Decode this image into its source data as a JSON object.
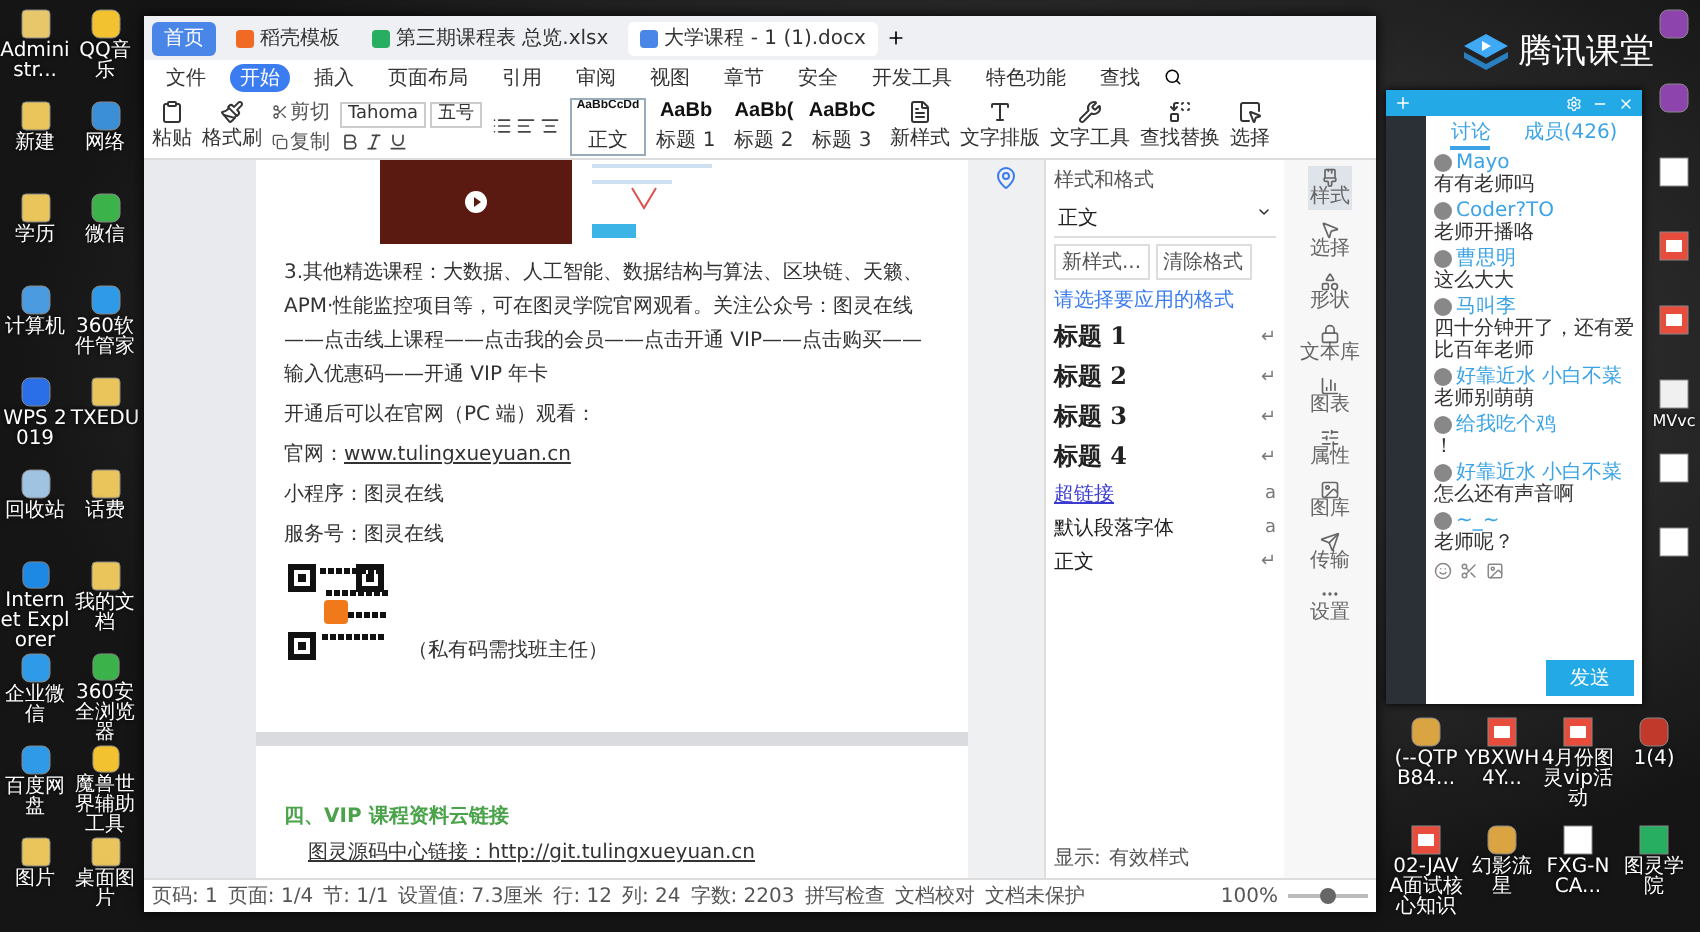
{
  "desktop_left": [
    {
      "label": "Administr...",
      "kind": "user"
    },
    {
      "label": "QQ音乐",
      "kind": "music"
    },
    {
      "label": "新建",
      "kind": "folder"
    },
    {
      "label": "网络",
      "kind": "network"
    },
    {
      "label": "学历",
      "kind": "folder"
    },
    {
      "label": "微信",
      "kind": "chat"
    },
    {
      "label": "计算机",
      "kind": "computer"
    },
    {
      "label": "360软件管家",
      "kind": "app"
    },
    {
      "label": "WPS 2019",
      "kind": "wps"
    },
    {
      "label": "TXEDU",
      "kind": "folder"
    },
    {
      "label": "回收站",
      "kind": "recycle"
    },
    {
      "label": "话费",
      "kind": "folder"
    },
    {
      "label": "Internet Explorer",
      "kind": "browser"
    },
    {
      "label": "我的文档",
      "kind": "folder"
    },
    {
      "label": "企业微信",
      "kind": "app"
    },
    {
      "label": "360安全浏览器",
      "kind": "chat"
    },
    {
      "label": "百度网盘",
      "kind": "app"
    },
    {
      "label": "魔兽世界辅助工具",
      "kind": "music"
    },
    {
      "label": "图片",
      "kind": "folder"
    },
    {
      "label": "桌面图片",
      "kind": "folder"
    }
  ],
  "desktop_right": [
    {
      "kind": "archive"
    },
    {
      "kind": "archive"
    },
    {
      "kind": "document"
    },
    {
      "kind": "pdf"
    },
    {
      "kind": "pdf"
    },
    {
      "kind": "blank",
      "label": "MVvc"
    },
    {
      "kind": "document"
    },
    {
      "kind": "document"
    }
  ],
  "desktop_bottom": [
    {
      "label": "(--QTPB84...",
      "kind": "image"
    },
    {
      "label": "YBXWH4Y...",
      "kind": "pdf"
    },
    {
      "label": "4月份图灵vip活动",
      "kind": "pdf"
    },
    {
      "label": "1(4)",
      "kind": "stamp"
    },
    {
      "label": "02-JAVA面试核心知识",
      "kind": "pdf"
    },
    {
      "label": "幻影流星",
      "kind": "image"
    },
    {
      "label": "FXG-NCA...",
      "kind": "document"
    },
    {
      "label": "图灵学院",
      "kind": "sheet"
    }
  ],
  "wps": {
    "tabs": [
      {
        "label": "首页",
        "kind": "home",
        "selected": false
      },
      {
        "label": "稻壳模板",
        "kind": "docer",
        "selected": false
      },
      {
        "label": "第三期课程表 总览.xlsx",
        "kind": "sheet",
        "selected": false
      },
      {
        "label": "大学课程 - 1 (1).docx",
        "kind": "doc",
        "selected": true
      }
    ],
    "menu": [
      {
        "label": "文件",
        "selected": false
      },
      {
        "label": "开始",
        "selected": true
      },
      {
        "label": "插入",
        "selected": false
      },
      {
        "label": "页面布局",
        "selected": false
      },
      {
        "label": "引用",
        "selected": false
      },
      {
        "label": "审阅",
        "selected": false
      },
      {
        "label": "视图",
        "selected": false
      },
      {
        "label": "章节",
        "selected": false
      },
      {
        "label": "安全",
        "selected": false
      },
      {
        "label": "开发工具",
        "selected": false
      },
      {
        "label": "特色功能",
        "selected": false
      },
      {
        "label": "查找",
        "selected": false
      }
    ],
    "clipboard": [
      {
        "label": "粘贴",
        "kind": "paste"
      },
      {
        "label": "格式刷",
        "kind": "brush"
      }
    ],
    "clipboard_small": [
      {
        "label": "剪切",
        "kind": "cut"
      },
      {
        "label": "复制",
        "kind": "copy"
      }
    ],
    "font": "Tahoma",
    "size": "五号",
    "styles": [
      {
        "preview": "AaBbCcDd",
        "label": "正文",
        "selected": true
      },
      {
        "preview": "AaBb",
        "label": "标题 1",
        "selected": false
      },
      {
        "preview": "AaBb(",
        "label": "标题 2",
        "selected": false
      },
      {
        "preview": "AaBbC",
        "label": "标题 3",
        "selected": false
      }
    ],
    "tools": [
      "新样式",
      "文字排版",
      "文字工具",
      "查找替换",
      "选择"
    ],
    "page1": {
      "paragraph": "3.其他精选课程：大数据、人工智能、数据结构与算法、区块链、天籁、APM·性能监控项目等，可在图灵学院官网观看。关注公众号：图灵在线——点击线上课程——点击我的会员——点击开通 VIP——点击购买——输入优惠码——开通 VIP 年卡",
      "lines": [
        {
          "label": "开通后可以在官网（PC 端）观看："
        },
        {
          "label": "官网：",
          "link": "www.tulingxueyuan.cn"
        },
        {
          "label": "小程序：图灵在线"
        },
        {
          "label": "服务号：图灵在线"
        }
      ],
      "caption": "（私有码需找班主任）"
    },
    "page2": {
      "heading": "四、VIP 课程资料云链接",
      "link": "图灵源码中心链接：http://git.tulingxueyuan.cn"
    },
    "style_panel": {
      "title": "样式和格式",
      "current": "正文",
      "buttons": [
        "新样式...",
        "清除格式"
      ],
      "hint": "请选择要应用的格式",
      "items": [
        {
          "label": "标题 1",
          "kind": "heading",
          "mark": "↵"
        },
        {
          "label": "标题 2",
          "kind": "heading",
          "mark": "↵"
        },
        {
          "label": "标题 3",
          "kind": "heading",
          "mark": "↵"
        },
        {
          "label": "标题 4",
          "kind": "heading",
          "mark": "↵"
        },
        {
          "label": "超链接",
          "kind": "link",
          "mark": "a"
        },
        {
          "label": "默认段落字体",
          "kind": "plain",
          "mark": "a"
        },
        {
          "label": "正文",
          "kind": "plain",
          "mark": "↵"
        }
      ],
      "show_label": "显示:",
      "show_value": "有效样式"
    },
    "sidebar": [
      {
        "label": "样式",
        "kind": "style",
        "selected": true
      },
      {
        "label": "选择",
        "kind": "select",
        "selected": false
      },
      {
        "label": "形状",
        "kind": "shape",
        "selected": false
      },
      {
        "label": "文本库",
        "kind": "lock",
        "selected": false
      },
      {
        "label": "图表",
        "kind": "chart",
        "selected": false
      },
      {
        "label": "属性",
        "kind": "props",
        "selected": false
      },
      {
        "label": "图库",
        "kind": "image",
        "selected": false
      },
      {
        "label": "传输",
        "kind": "send",
        "selected": false
      },
      {
        "label": "设置",
        "kind": "more",
        "selected": false
      }
    ],
    "status": [
      "页码: 1",
      "页面: 1/4",
      "节: 1/1",
      "设置值: 7.3厘米",
      "行: 12",
      "列: 24",
      "字数: 2203",
      "拼写检查",
      "文档校对",
      "文档未保护"
    ],
    "zoom": {
      "label": "100%",
      "level": 0.5
    }
  },
  "classroom": {
    "logo": "腾讯课堂",
    "tabs": [
      {
        "label": "讨论",
        "selected": true
      },
      {
        "label": "成员(426)",
        "selected": false
      }
    ],
    "messages": [
      {
        "name": "Mayo",
        "text": "有有老师吗"
      },
      {
        "name": "Coder?TO",
        "text": "老师开播咯"
      },
      {
        "name": "曹思明",
        "text": "这么大大"
      },
      {
        "name": "马叫李",
        "text": "四十分钟开了，还有爱比百年老师"
      },
      {
        "name": "好靠近水 小白不菜",
        "text": "老师别萌萌"
      },
      {
        "name": "给我吃个鸡",
        "text": "！"
      },
      {
        "name": "好靠近水 小白不菜",
        "text": "怎么还有声音啊"
      },
      {
        "name": "~_~",
        "text": "老师呢？"
      }
    ],
    "send": "发送"
  }
}
